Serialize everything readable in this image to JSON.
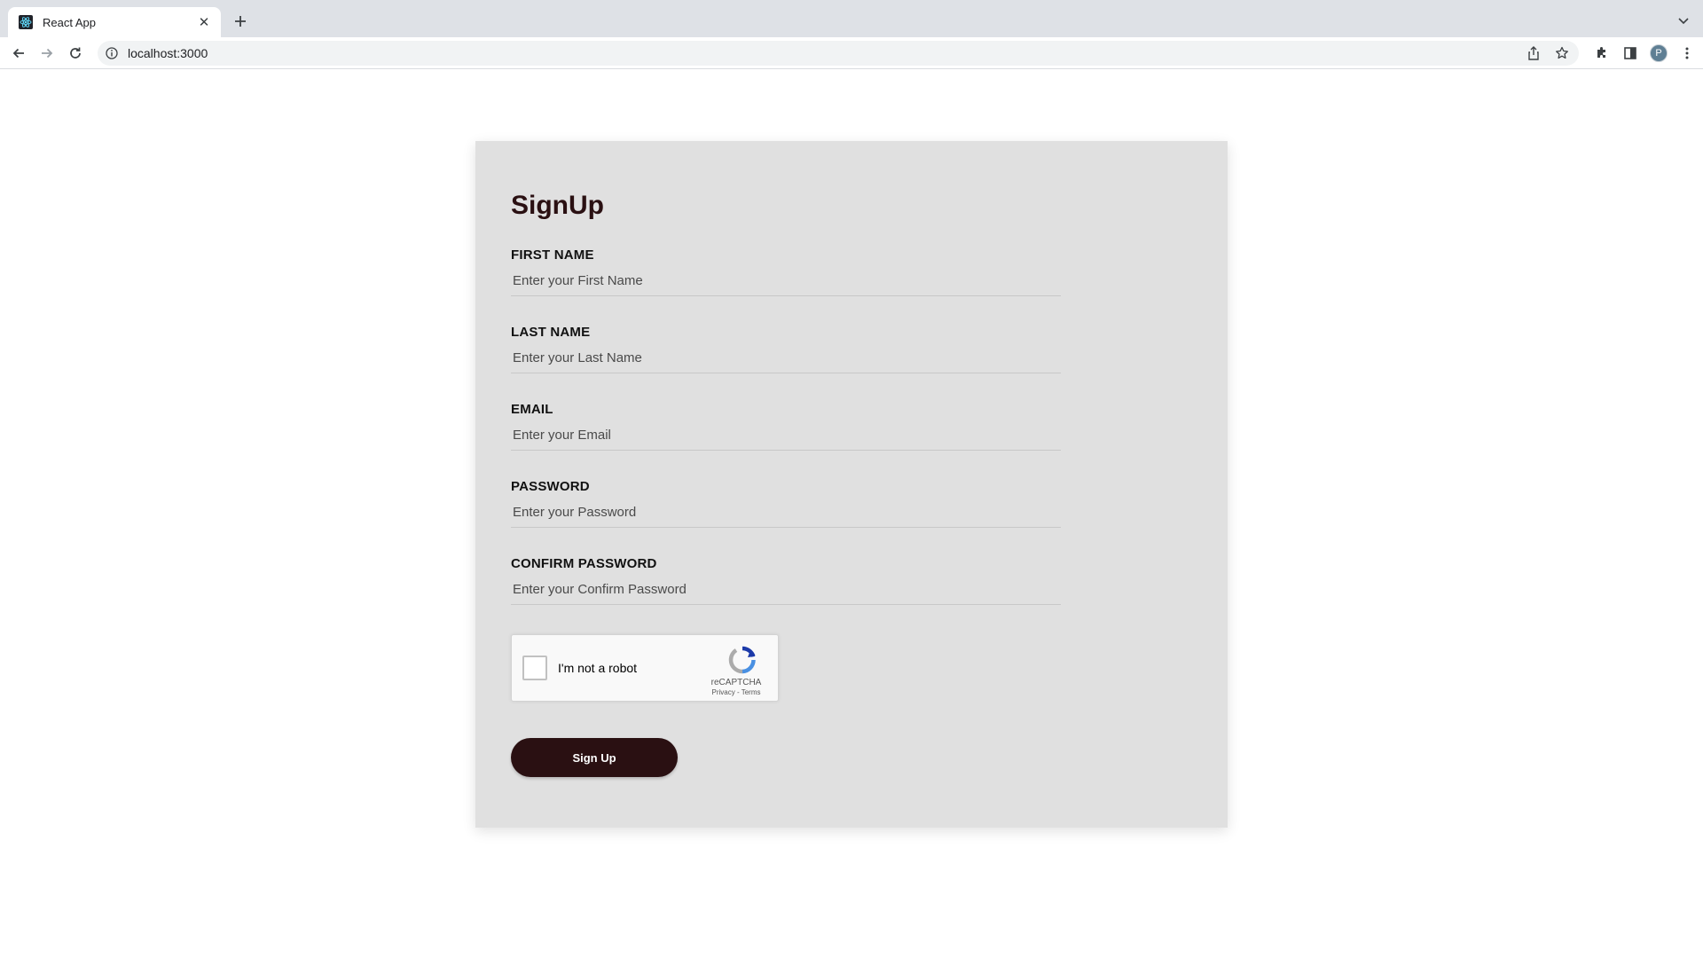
{
  "browser": {
    "tab_title": "React App",
    "url": "localhost:3000",
    "profile_initial": "P"
  },
  "form": {
    "title": "SignUp",
    "fields": [
      {
        "label": "FIRST NAME",
        "placeholder": "Enter your First Name"
      },
      {
        "label": "LAST NAME",
        "placeholder": "Enter your Last Name"
      },
      {
        "label": "EMAIL",
        "placeholder": "Enter your Email"
      },
      {
        "label": "PASSWORD",
        "placeholder": "Enter your Password"
      },
      {
        "label": "CONFIRM PASSWORD",
        "placeholder": "Enter your Confirm Password"
      }
    ],
    "captcha": {
      "label": "I'm not a robot",
      "brand": "reCAPTCHA",
      "privacy": "Privacy",
      "separator": " - ",
      "terms": "Terms"
    },
    "submit_label": "Sign Up"
  },
  "colors": {
    "card_bg": "#e0e0e0",
    "accent": "#2a1012",
    "tabstrip_bg": "#dee1e6"
  }
}
